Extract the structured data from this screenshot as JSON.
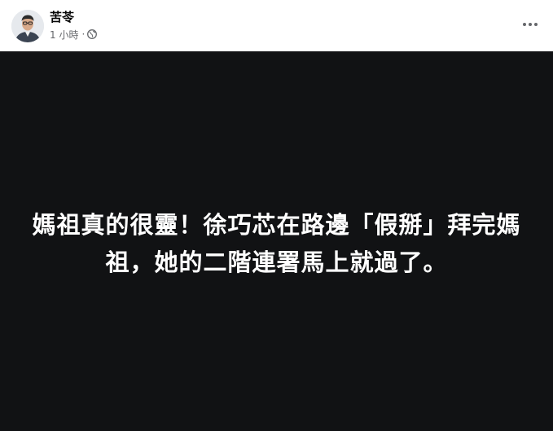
{
  "post": {
    "author": "苦苓",
    "timestamp": "1 小時",
    "meta_separator": "·",
    "privacy_icon": "globe-icon",
    "more_icon": "more-options-icon",
    "image": {
      "background_color": "#111214",
      "text_color": "#ffffff",
      "text_lines": [
        "媽祖真的很靈！徐巧芯在路邊「假掰」拜完媽",
        "祖，她的二階連署馬上就過了。"
      ]
    }
  }
}
